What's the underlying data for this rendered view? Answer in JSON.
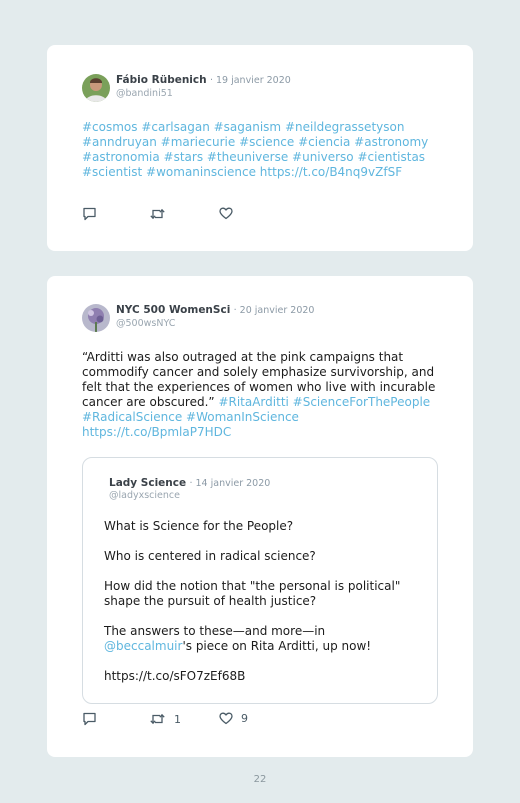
{
  "tweets": [
    {
      "name": "Fábio Rübenich",
      "date": "· 19 janvier 2020",
      "handle": "@bandini51",
      "lines": [
        "#cosmos #carlsagan #saganism #neildegrassetyson",
        "#anndruyan #mariecurie #science #ciencia #astronomy",
        "#astronomia #stars #theuniverse #universo #cientistas",
        "#scientist #womaninscience https://t.co/B4nq9vZfSF"
      ]
    },
    {
      "name": "NYC 500 WomenSci",
      "date": "· 20 janvier 2020",
      "handle": "@500wsNYC",
      "text_lines": [
        "“Arditti was also outraged at the pink campaigns that",
        "commodify cancer and solely emphasize survivorship, and",
        "felt that the experiences of women who live with incurable",
        "cancer are obscured.”"
      ],
      "tag_after_text": " #RitaArditti #ScienceForThePeople",
      "tag_lines": [
        "#RadicalScience #WomanInScience",
        "https://t.co/BpmlaP7HDC"
      ],
      "retweets": "1",
      "likes": "9",
      "quote": {
        "name": "Lady Science",
        "date": "· 14 janvier 2020",
        "handle": "@ladyxscience",
        "p1": "What is Science for the People?",
        "p2": "Who is centered in radical science?",
        "p3_line1": "How did the notion that \"the personal is political\"",
        "p3_line2": "shape the pursuit of health justice?",
        "p4_line1": "The answers to these—and more—in",
        "p4_mention": "@beccalmuir",
        "p4_rest": "'s piece on Rita Arditti, up now!",
        "link": "https://t.co/sFO7zEf68B"
      }
    }
  ],
  "page_number": "22",
  "colors": {
    "background": "#e3ebed",
    "card": "#ffffff",
    "link": "#5fb6de",
    "icon": "#4a5b66"
  },
  "icons": [
    "reply-icon",
    "retweet-icon",
    "like-icon"
  ]
}
